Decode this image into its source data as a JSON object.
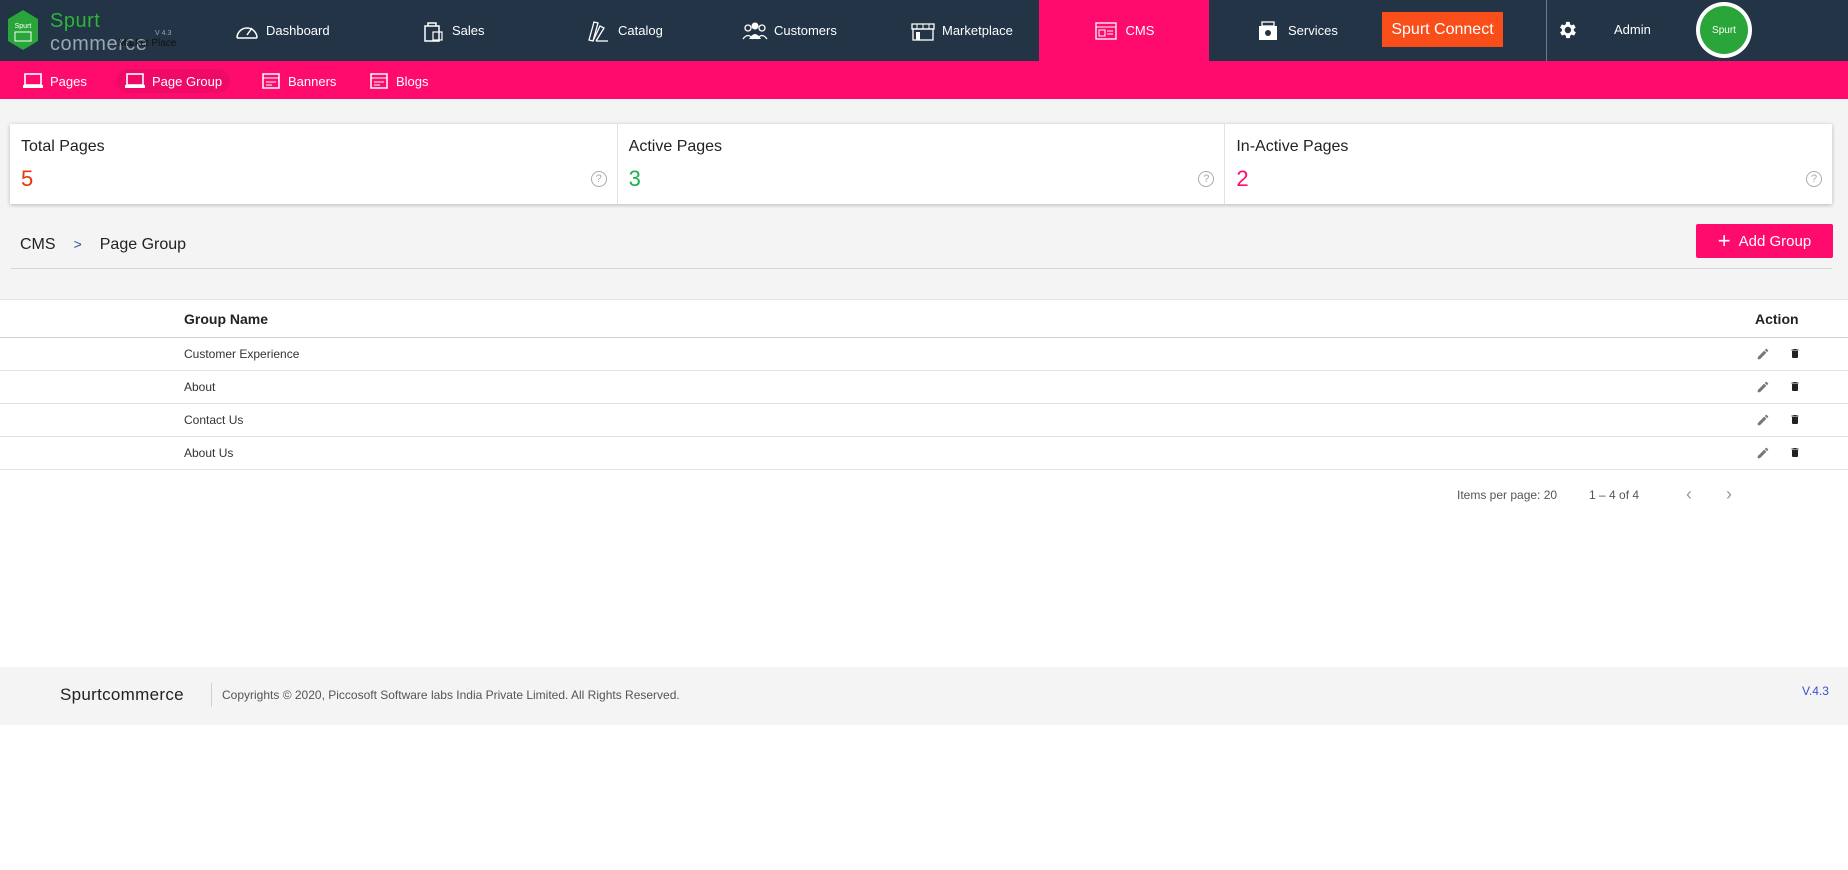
{
  "logo": {
    "word1": "Spurt",
    "word2": "commerce",
    "version": "V 4.3",
    "subtitle": "Market Place",
    "hex_text": "Spurt"
  },
  "nav": {
    "items": [
      {
        "label": "Dashboard"
      },
      {
        "label": "Sales"
      },
      {
        "label": "Catalog"
      },
      {
        "label": "Customers"
      },
      {
        "label": "Marketplace"
      },
      {
        "label": "CMS"
      },
      {
        "label": "Services"
      }
    ],
    "connect_label": "Spurt Connect",
    "admin_label": "Admin",
    "avatar_text": "Spurt"
  },
  "subnav": {
    "items": [
      {
        "label": "Pages"
      },
      {
        "label": "Page Group"
      },
      {
        "label": "Banners"
      },
      {
        "label": "Blogs"
      }
    ]
  },
  "stats": [
    {
      "label": "Total Pages",
      "value": "5",
      "color": "#e8340f"
    },
    {
      "label": "Active Pages",
      "value": "3",
      "color": "#1ab04b"
    },
    {
      "label": "In-Active Pages",
      "value": "2",
      "color": "#ff0b6e"
    }
  ],
  "breadcrumb": {
    "root": "CMS",
    "sep": ">",
    "current": "Page Group"
  },
  "add_button_label": "Add Group",
  "table": {
    "headers": {
      "name": "Group Name",
      "action": "Action"
    },
    "rows": [
      {
        "name": "Customer Experience"
      },
      {
        "name": "About"
      },
      {
        "name": "Contact Us"
      },
      {
        "name": "About Us"
      }
    ]
  },
  "pager": {
    "items_per_page": "Items per page: 20",
    "range": "1 – 4 of 4",
    "prev": "‹",
    "next": "›"
  },
  "footer": {
    "brand": "Spurtcommerce",
    "copyright": "Copyrights © 2020, Piccosoft Software labs India Private Limited. All Rights Reserved.",
    "version": "V.4.3"
  },
  "colors": {
    "topbar": "#223445",
    "accent": "#ff0b6e",
    "connect": "#f94d1a"
  }
}
